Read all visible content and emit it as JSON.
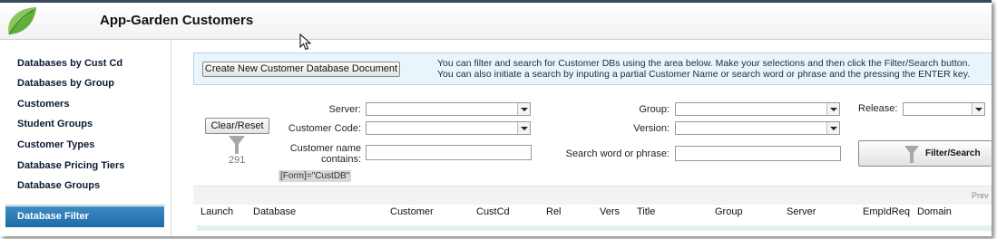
{
  "header": {
    "title": "App-Garden Customers"
  },
  "sidebar": {
    "items": [
      {
        "label": "Databases by Cust Cd"
      },
      {
        "label": "Databases by Group"
      },
      {
        "label": "Customers"
      },
      {
        "label": "Student Groups"
      },
      {
        "label": "Customer Types"
      },
      {
        "label": "Database Pricing Tiers"
      },
      {
        "label": "Database Groups"
      }
    ],
    "active": {
      "label": "Database Filter"
    }
  },
  "info": {
    "create_button": "Create New Customer Database Document",
    "line1": "You can filter and search for Customer DBs using the area below. Make your selections and then click the Filter/Search button.",
    "line2": "You can also initiate a search by inputing a partial Customer Name or search word or phrase and the pressing the ENTER key."
  },
  "filter": {
    "clear_reset": "Clear/Reset",
    "count": "291",
    "server_label": "Server:",
    "customer_code_label": "Customer Code:",
    "customer_name_label_1": "Customer name",
    "customer_name_label_2": "contains:",
    "group_label": "Group:",
    "version_label": "Version:",
    "search_label": "Search word or phrase:",
    "release_label": "Release:",
    "filter_search_button": "Filter/Search",
    "formula": "[Form]=\"CustDB\""
  },
  "table": {
    "prev_label": "Prev",
    "columns": [
      "Launch",
      "Database",
      "Customer",
      "CustCd",
      "Rel",
      "Vers",
      "Title",
      "Group",
      "Server",
      "EmpIdReq",
      "Domain"
    ]
  },
  "colors": {
    "accent": "#1e6aa6",
    "info_bg": "#eaf4fb"
  }
}
